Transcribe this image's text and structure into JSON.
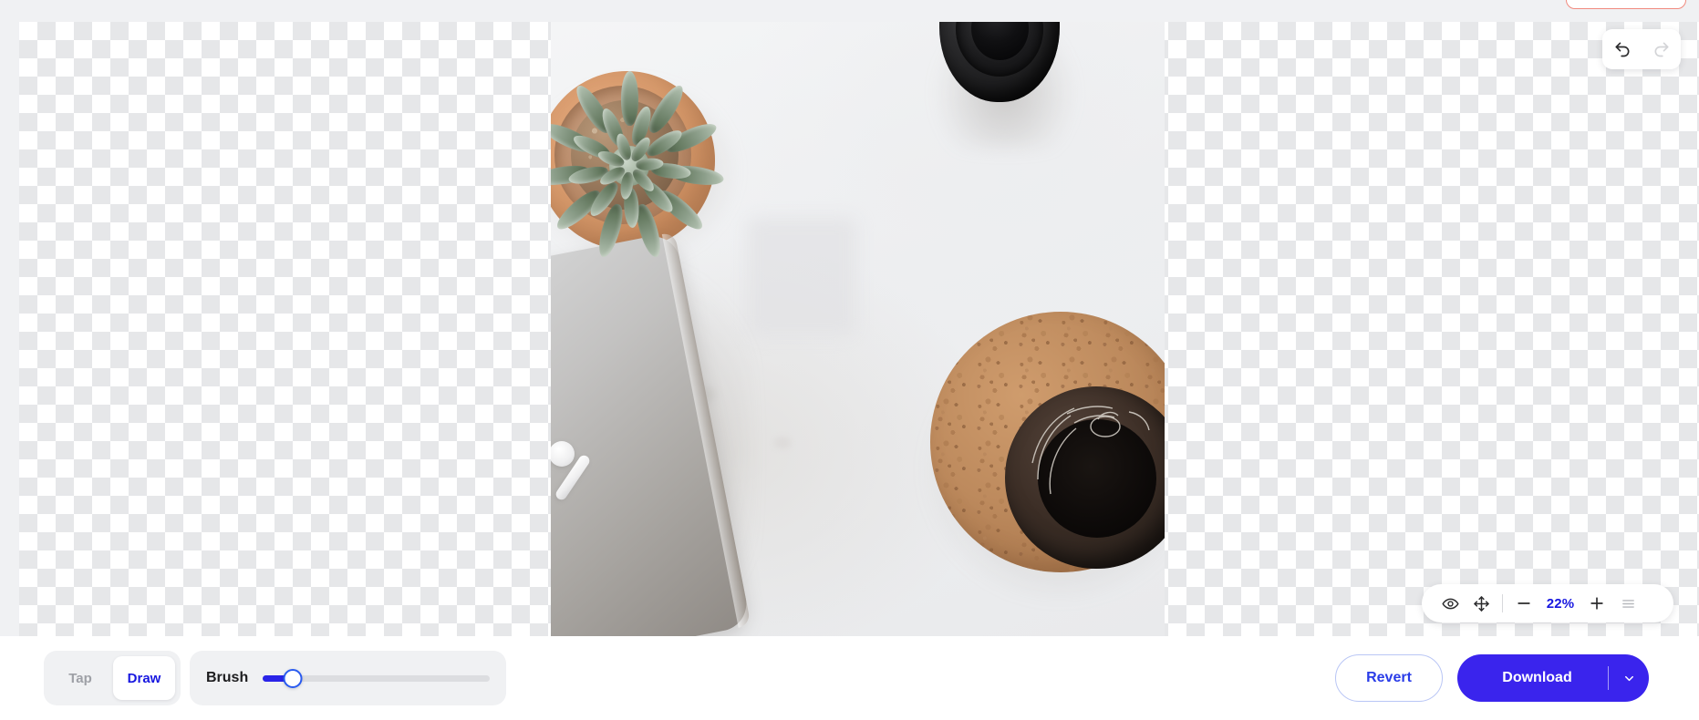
{
  "app": {
    "canvas_background": "transparent-checkerboard"
  },
  "history": {
    "undo_icon": "undo-arrow-icon",
    "redo_icon": "redo-arrow-icon",
    "undo_enabled": true,
    "redo_enabled": false
  },
  "zoom_bar": {
    "preview_icon": "eye-icon",
    "pan_icon": "move-icon",
    "zoom_out_icon": "minus-icon",
    "zoom_level": "22%",
    "zoom_in_icon": "plus-icon",
    "menu_icon": "hamburger-menu-icon"
  },
  "toolbar": {
    "modes": [
      {
        "label": "Tap",
        "active": false
      },
      {
        "label": "Draw",
        "active": true
      }
    ],
    "brush": {
      "label": "Brush",
      "value": 13,
      "min": 0,
      "max": 100
    },
    "revert_label": "Revert",
    "download_label": "Download",
    "download_caret_icon": "chevron-down-icon"
  },
  "colors": {
    "accent": "#3a24ed",
    "accent_text": "#1717e0",
    "panel": "#f0f1f3",
    "muted_text": "#9ea0a6"
  },
  "image": {
    "alt": "Flat-lay photo of a white desk with a succulent in a terracotta pot, a camera lens, a phone with sticker, wireless earbuds, and a dark mug on a cork coaster"
  }
}
